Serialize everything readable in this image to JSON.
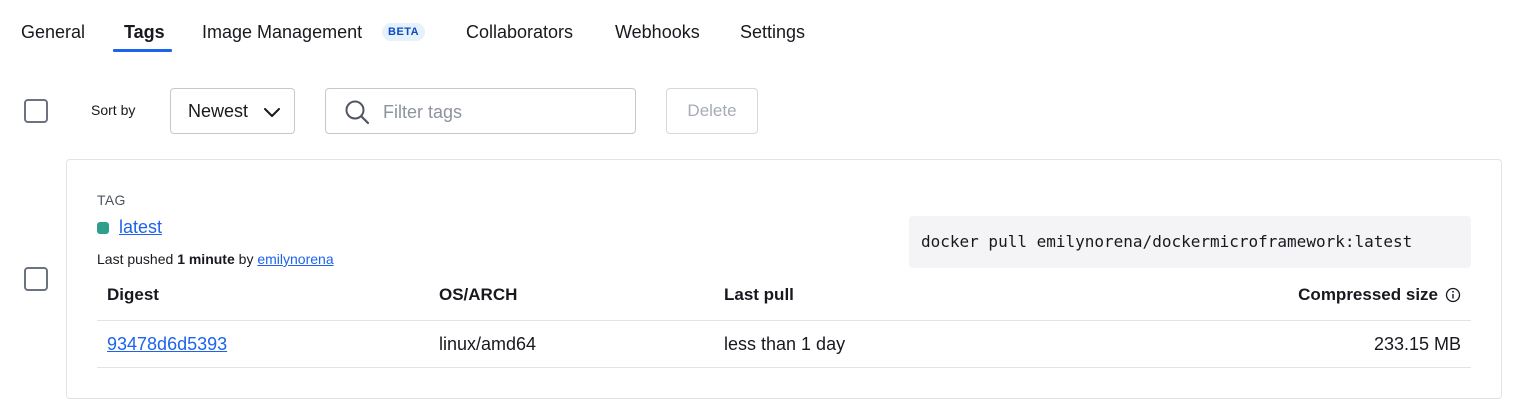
{
  "tabs": {
    "general": "General",
    "tags": "Tags",
    "image_management": "Image Management",
    "beta_badge": "BETA",
    "collaborators": "Collaborators",
    "webhooks": "Webhooks",
    "settings": "Settings",
    "active": "Tags"
  },
  "toolbar": {
    "sort_label": "Sort by",
    "sort_value": "Newest",
    "filter_placeholder": "Filter tags",
    "filter_value": "",
    "delete_label": "Delete"
  },
  "tag_card": {
    "heading": "TAG",
    "tag_name": "latest",
    "status_color": "#2e9f8a",
    "pushed_prefix": "Last pushed",
    "pushed_time": "1 minute",
    "pushed_by": "by",
    "pushed_user": "emilynorena",
    "pull_command": "docker pull emilynorena/dockermicroframework:latest",
    "table": {
      "headers": {
        "digest": "Digest",
        "os_arch": "OS/ARCH",
        "last_pull": "Last pull",
        "size": "Compressed size"
      },
      "rows": [
        {
          "digest": "93478d6d5393",
          "os_arch": "linux/amd64",
          "last_pull": "less than 1 day",
          "size": "233.15 MB"
        }
      ]
    }
  },
  "colors": {
    "accent": "#1d63ed",
    "text": "#17191e"
  }
}
